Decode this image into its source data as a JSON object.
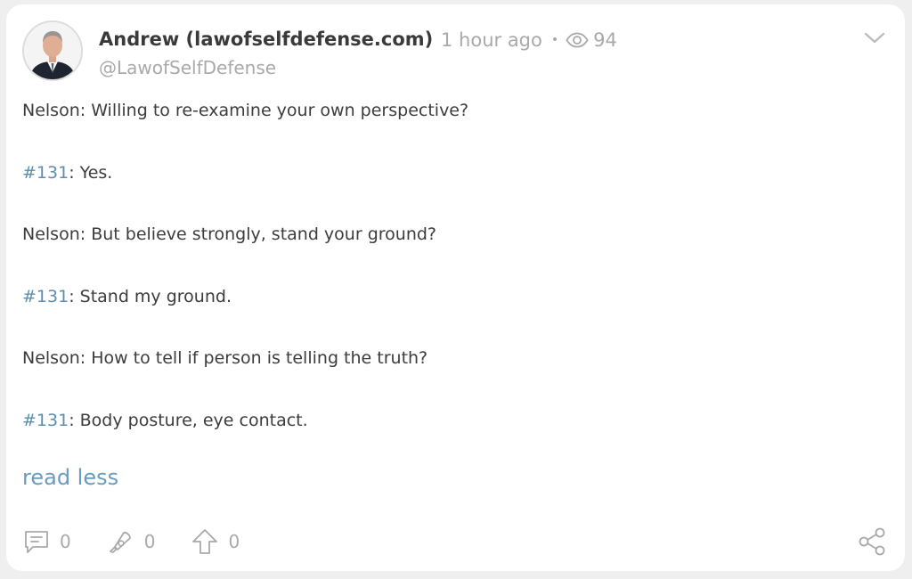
{
  "post": {
    "author_name": "Andrew (lawofselfdefense.com)",
    "handle": "@LawofSelfDefense",
    "time_ago": "1 hour ago",
    "separator": "•",
    "views": "94",
    "lines": [
      {
        "speaker": "Nelson",
        "text": ": Willing to re-examine your own perspective?"
      },
      {
        "speaker": "#131",
        "text": ": Yes."
      },
      {
        "speaker": "Nelson",
        "text": ": But believe strongly, stand your ground?"
      },
      {
        "speaker": "#131",
        "text": ": Stand my ground."
      },
      {
        "speaker": "Nelson",
        "text": ": How to tell if person is telling the truth?"
      },
      {
        "speaker": "#131",
        "text": ": Body posture, eye contact."
      }
    ],
    "read_less_label": "read less"
  },
  "actions": {
    "comments": "0",
    "reposts": "0",
    "boosts": "0"
  },
  "colors": {
    "link": "#6a9bbd",
    "tag": "#5b8fb0",
    "muted": "#a9a9a9",
    "text": "#3c3c3c"
  },
  "icons": {
    "avatar": "avatar-portrait",
    "views": "eye-icon",
    "menu": "chevron-down-icon",
    "comment": "comment-icon",
    "repost": "repost-icon",
    "boost": "boost-arrow-up-icon",
    "share": "share-icon"
  }
}
